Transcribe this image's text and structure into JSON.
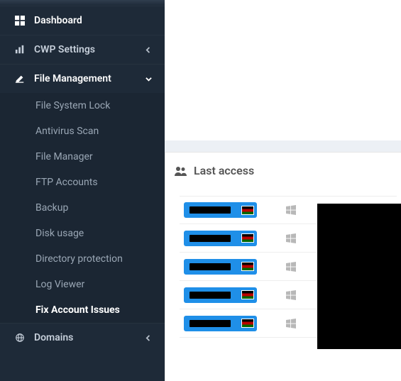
{
  "sidebar": {
    "items": [
      {
        "label": "Dashboard"
      },
      {
        "label": "CWP Settings"
      },
      {
        "label": "File Management"
      },
      {
        "label": "Domains"
      }
    ],
    "fileManagement": [
      {
        "label": "File System Lock"
      },
      {
        "label": "Antivirus Scan"
      },
      {
        "label": "File Manager"
      },
      {
        "label": "FTP Accounts"
      },
      {
        "label": "Backup"
      },
      {
        "label": "Disk usage"
      },
      {
        "label": "Directory protection"
      },
      {
        "label": "Log Viewer"
      },
      {
        "label": "Fix Account Issues"
      }
    ]
  },
  "panel": {
    "title": "Last access"
  },
  "access_rows": [
    {
      "os": "windows"
    },
    {
      "os": "windows"
    },
    {
      "os": "windows"
    },
    {
      "os": "windows"
    },
    {
      "os": "windows"
    }
  ]
}
